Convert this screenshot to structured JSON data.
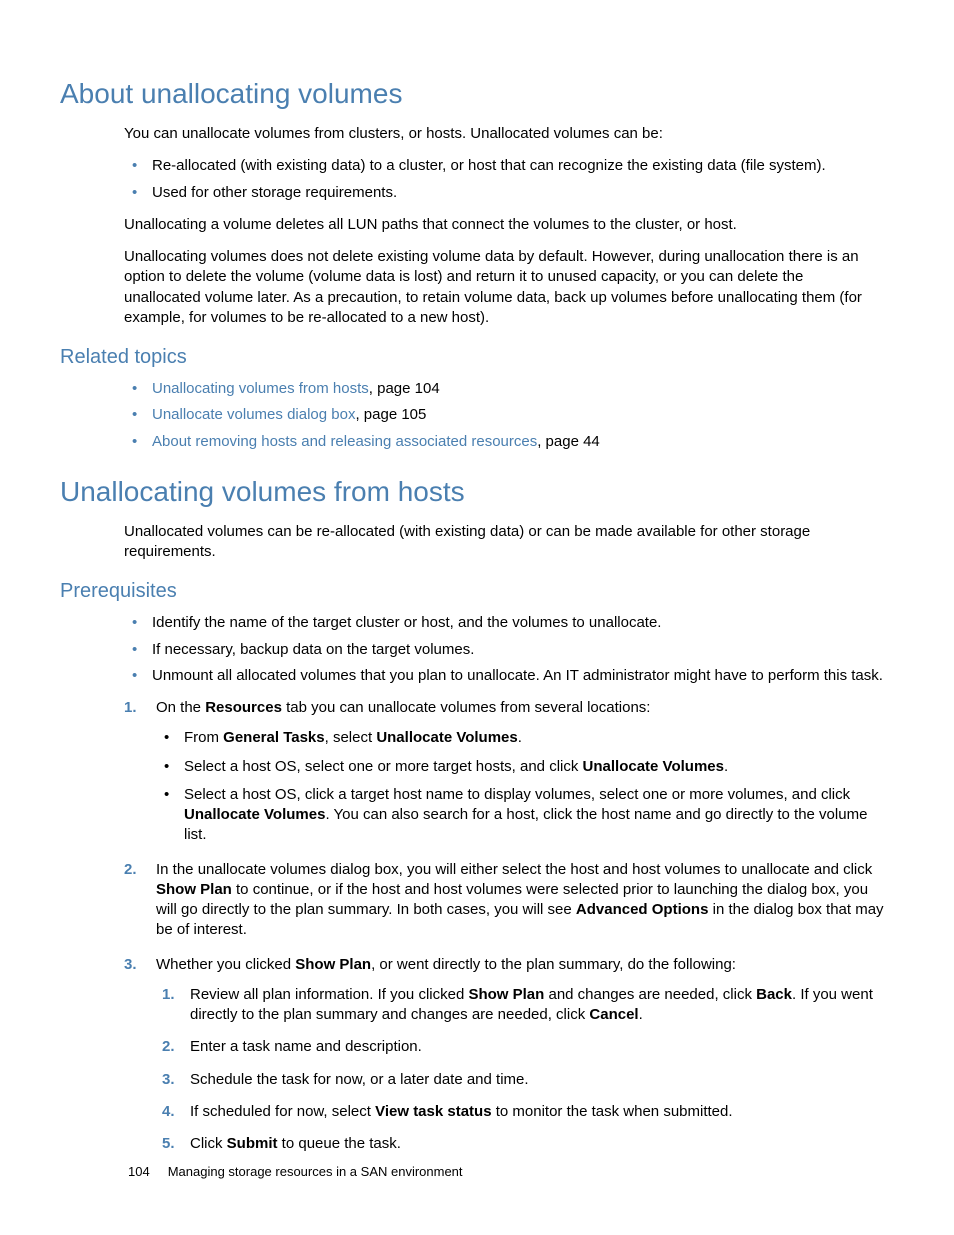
{
  "sections": {
    "about": {
      "title": "About unallocating volumes",
      "intro": "You can unallocate volumes from clusters, or hosts. Unallocated volumes can be:",
      "bullets": [
        "Re-allocated (with existing data) to a cluster, or host that can recognize the existing data (file system).",
        "Used for other storage requirements."
      ],
      "p1": "Unallocating a volume deletes all LUN paths that connect the volumes to the cluster, or host.",
      "p2": "Unallocating volumes does not delete existing volume data by default. However, during unallocation there is an option to delete the volume (volume data is lost) and return it to unused capacity, or you can delete the unallocated volume later. As a precaution, to retain volume data, back up volumes before unallocating them (for example, for volumes to be re-allocated to a new host)."
    },
    "related": {
      "title": "Related topics",
      "items": [
        {
          "link": "Unallocating volumes from hosts",
          "suffix": ", page 104"
        },
        {
          "link": "Unallocate volumes dialog box",
          "suffix": ", page 105"
        },
        {
          "link": "About removing hosts and releasing associated resources",
          "suffix": ", page 44"
        }
      ]
    },
    "unalloc": {
      "title": "Unallocating volumes from hosts",
      "intro": "Unallocated volumes can be re-allocated (with existing data) or can be made available for other storage requirements."
    },
    "prereq": {
      "title": "Prerequisites",
      "bullets": [
        "Identify the name of the target cluster or host, and the volumes to unallocate.",
        "If necessary, backup data on the target volumes.",
        "Unmount all allocated volumes that you plan to unallocate. An IT administrator might have to perform this task."
      ],
      "step1": {
        "pre": "On the ",
        "b1": "Resources",
        "post": " tab you can unallocate volumes from several locations:",
        "sub": [
          {
            "pre": "From ",
            "b1": "General Tasks",
            "mid": ", select ",
            "b2": "Unallocate Volumes",
            "post": "."
          },
          {
            "pre": "Select a host OS, select one or more target hosts, and click ",
            "b1": "Unallocate Volumes",
            "post": "."
          },
          {
            "pre": "Select a host OS, click a target host name to display volumes, select one or more volumes, and click ",
            "b1": "Unallocate Volumes",
            "post": ". You can also search for a host, click the host name and go directly to the volume list."
          }
        ]
      },
      "step2": {
        "pre": "In the unallocate volumes dialog box, you will either select the host and host volumes to unallocate and click ",
        "b1": "Show Plan",
        "mid": " to continue, or if the host and host volumes were selected prior to launching the dialog box, you will go directly to the plan summary. In both cases, you will see ",
        "b2": "Advanced Options",
        "post": " in the dialog box that may be of interest."
      },
      "step3": {
        "pre": "Whether you clicked ",
        "b1": "Show Plan",
        "post": ", or went directly to the plan summary, do the following:",
        "sub": [
          {
            "pre": "Review all plan information. If you clicked ",
            "b1": "Show Plan",
            "mid": " and changes are needed, click ",
            "b2": "Back",
            "mid2": ". If you went directly to the plan summary and changes are needed, click ",
            "b3": "Cancel",
            "post": "."
          },
          {
            "text": "Enter a task name and description."
          },
          {
            "text": "Schedule the task for now, or a later date and time."
          },
          {
            "pre": "If scheduled for now, select ",
            "b1": "View task status",
            "post": " to monitor the task when submitted."
          },
          {
            "pre": "Click ",
            "b1": "Submit",
            "post": " to queue the task."
          }
        ]
      }
    }
  },
  "footer": {
    "page": "104",
    "chapter": "Managing storage resources in a SAN environment"
  }
}
